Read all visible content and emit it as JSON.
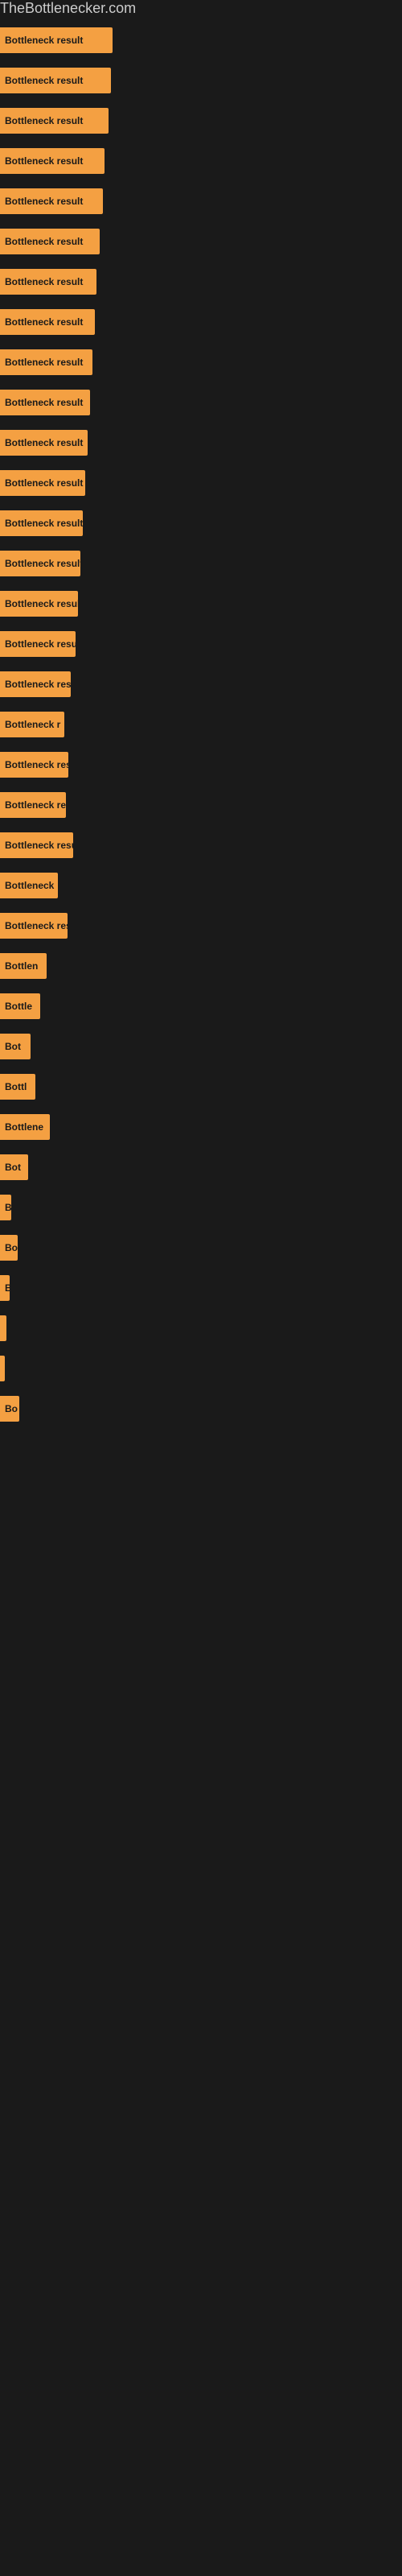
{
  "site": {
    "title": "TheBottlenecker.com"
  },
  "bars": [
    {
      "id": 1,
      "label": "Bottleneck result",
      "width": 140
    },
    {
      "id": 2,
      "label": "Bottleneck result",
      "width": 138
    },
    {
      "id": 3,
      "label": "Bottleneck result",
      "width": 135
    },
    {
      "id": 4,
      "label": "Bottleneck result",
      "width": 130
    },
    {
      "id": 5,
      "label": "Bottleneck result",
      "width": 128
    },
    {
      "id": 6,
      "label": "Bottleneck result",
      "width": 124
    },
    {
      "id": 7,
      "label": "Bottleneck result",
      "width": 120
    },
    {
      "id": 8,
      "label": "Bottleneck result",
      "width": 118
    },
    {
      "id": 9,
      "label": "Bottleneck result",
      "width": 115
    },
    {
      "id": 10,
      "label": "Bottleneck result",
      "width": 112
    },
    {
      "id": 11,
      "label": "Bottleneck result",
      "width": 109
    },
    {
      "id": 12,
      "label": "Bottleneck result",
      "width": 106
    },
    {
      "id": 13,
      "label": "Bottleneck result",
      "width": 103
    },
    {
      "id": 14,
      "label": "Bottleneck result",
      "width": 100
    },
    {
      "id": 15,
      "label": "Bottleneck result",
      "width": 97
    },
    {
      "id": 16,
      "label": "Bottleneck result",
      "width": 94
    },
    {
      "id": 17,
      "label": "Bottleneck resu",
      "width": 88
    },
    {
      "id": 18,
      "label": "Bottleneck r",
      "width": 80
    },
    {
      "id": 19,
      "label": "Bottleneck resu",
      "width": 85
    },
    {
      "id": 20,
      "label": "Bottleneck res",
      "width": 82
    },
    {
      "id": 21,
      "label": "Bottleneck result",
      "width": 91
    },
    {
      "id": 22,
      "label": "Bottleneck",
      "width": 72
    },
    {
      "id": 23,
      "label": "Bottleneck resu",
      "width": 84
    },
    {
      "id": 24,
      "label": "Bottlen",
      "width": 58
    },
    {
      "id": 25,
      "label": "Bottle",
      "width": 50
    },
    {
      "id": 26,
      "label": "Bot",
      "width": 38
    },
    {
      "id": 27,
      "label": "Bottl",
      "width": 44
    },
    {
      "id": 28,
      "label": "Bottlene",
      "width": 62
    },
    {
      "id": 29,
      "label": "Bot",
      "width": 35
    },
    {
      "id": 30,
      "label": "B",
      "width": 14
    },
    {
      "id": 31,
      "label": "Bo",
      "width": 22
    },
    {
      "id": 32,
      "label": "B",
      "width": 12
    },
    {
      "id": 33,
      "label": "",
      "width": 8
    },
    {
      "id": 34,
      "label": "",
      "width": 6
    },
    {
      "id": 35,
      "label": "Bo",
      "width": 24
    }
  ],
  "colors": {
    "bar_fill": "#f4a042",
    "background": "#1a1a1a",
    "title_color": "#cccccc",
    "label_color": "#1a1a1a"
  }
}
